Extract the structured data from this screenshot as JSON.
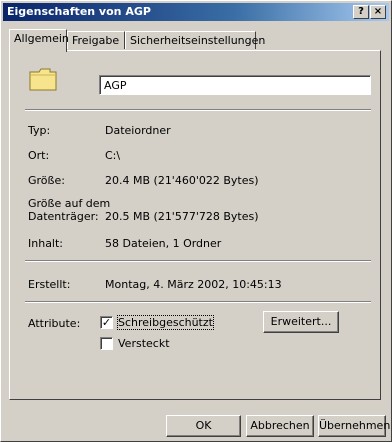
{
  "window": {
    "title": "Eigenschaften von AGP",
    "help_btn": "?",
    "close_btn": "×"
  },
  "tabs": [
    {
      "label": "Allgemein"
    },
    {
      "label": "Freigabe"
    },
    {
      "label": "Sicherheitseinstellungen"
    }
  ],
  "general": {
    "name_value": "AGP",
    "rows": [
      {
        "label": "Typ:",
        "value": "Dateiordner"
      },
      {
        "label": "Ort:",
        "value": "C:\\"
      },
      {
        "label": "Größe:",
        "value": "20.4 MB (21'460'022 Bytes)"
      },
      {
        "label": "Größe auf dem",
        "label2": "Datenträger:",
        "value": "20.5 MB (21'577'728 Bytes)"
      },
      {
        "label": "Inhalt:",
        "value": "58 Dateien, 1 Ordner"
      },
      {
        "label": "Erstellt:",
        "value": "Montag, 4. März 2002, 10:45:13"
      }
    ],
    "attributes_label": "Attribute:",
    "readonly": {
      "label": "Schreibgeschützt",
      "checked": true
    },
    "hidden": {
      "label": "Versteckt",
      "checked": false
    },
    "advanced_btn": "Erweitert..."
  },
  "footer": {
    "ok": "OK",
    "cancel": "Abbrechen",
    "apply": "Übernehmen"
  }
}
